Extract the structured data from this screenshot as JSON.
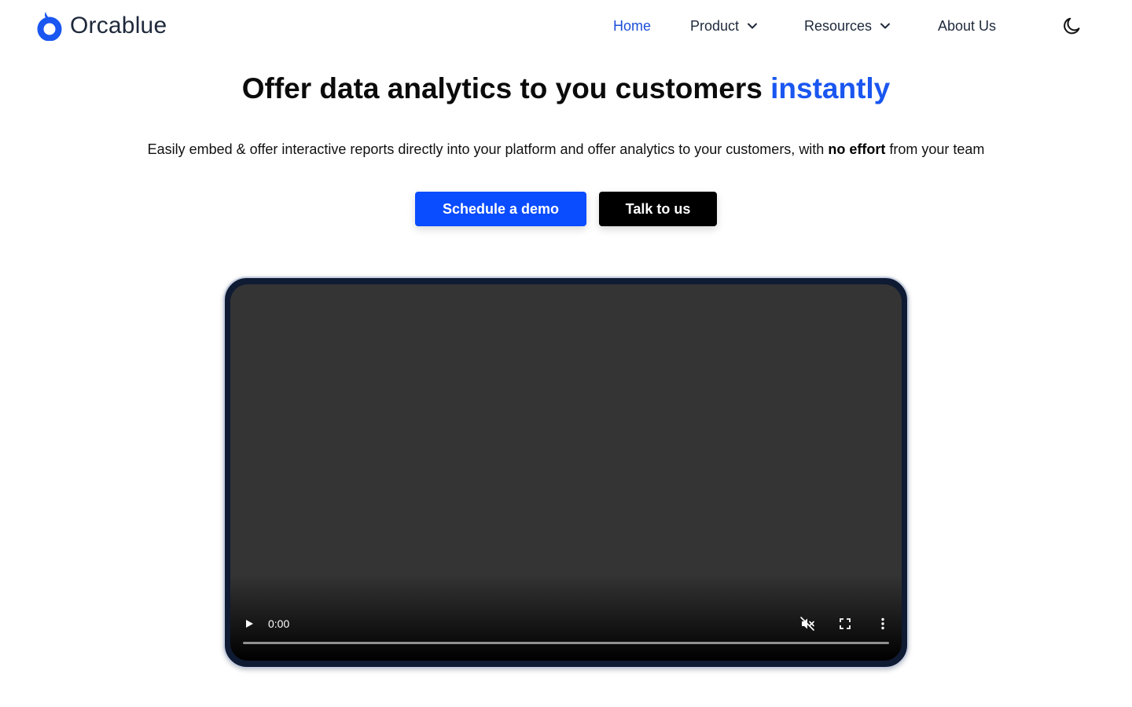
{
  "brand": {
    "name": "Orcablue",
    "logo_color": "#1a56f0"
  },
  "nav": {
    "items": [
      {
        "label": "Home",
        "active": true
      },
      {
        "label": "Product",
        "dropdown": true
      },
      {
        "label": "Resources",
        "dropdown": true
      },
      {
        "label": "About Us"
      }
    ],
    "theme_toggle_icon": "moon-icon"
  },
  "hero": {
    "title_main": "Offer data analytics to you customers",
    "title_accent": "instantly",
    "subtitle_before": "Easily embed & offer interactive reports directly into your platform and offer analytics to your customers, with",
    "subtitle_bold": "no effort",
    "subtitle_after": "from your team",
    "accent_color": "#1a56f0"
  },
  "buttons": {
    "primary_label": "Schedule a demo",
    "secondary_label": "Talk to us",
    "primary_color": "#0a4cff",
    "secondary_color": "#000000"
  },
  "video": {
    "time": "0:00",
    "progress": 0,
    "muted": true,
    "controls": [
      "play-icon",
      "mute-icon",
      "fullscreen-icon",
      "more-options-icon"
    ]
  }
}
